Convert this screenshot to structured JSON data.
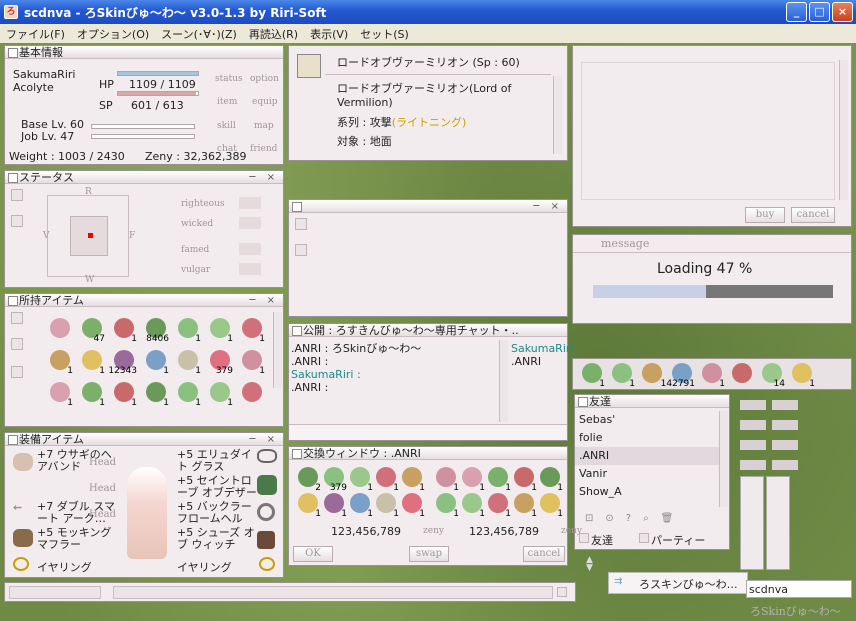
{
  "window": {
    "title": "scdnva - ろSkinびゅ～わ～ v3.0-1.3 by Riri-Soft",
    "controls": [
      "_",
      "□",
      "×"
    ]
  },
  "menu": [
    "ファイル(F)",
    "オプション(O)",
    "スーン(･∀･)(Z)",
    "再読込(R)",
    "表示(V)",
    "セット(S)"
  ],
  "basic": {
    "title": "基本情報",
    "name": "SakumaRiri",
    "job": "Acolyte",
    "hp_label": "HP",
    "hp": "1109 / 1109",
    "sp_label": "SP",
    "sp": "601 / 613",
    "base": "Base Lv. 60",
    "joblv": "Job Lv. 47",
    "weight": "Weight : 1003 / 2430",
    "zeny": "Zeny : 32,362,389",
    "hp_ratio": 1.0,
    "sp_ratio": 0.98,
    "buttons": [
      "status",
      "option",
      "item",
      "equip",
      "skill",
      "map",
      "chat",
      "friend"
    ],
    "ctl": "─ ×"
  },
  "skill": {
    "title": "ロードオブヴァーミリオン (Sp : 60)",
    "line1": "ロードオブヴァーミリオン(Lord of",
    "line2": "Vermilion)",
    "line3a": "系列 : 攻撃",
    "line3b": "(ライトニング)",
    "line4": "対象 : 地面"
  },
  "status": {
    "title": "ステータス",
    "n": "R",
    "s": "W",
    "w": "V",
    "e": "F",
    "labels": [
      "righteous",
      "wicked",
      "famed",
      "vulgar"
    ],
    "ctl": "─ ×"
  },
  "blank": {
    "ctl": "─ ×"
  },
  "items": {
    "title": "所持アイテム",
    "ctl": "─ ×",
    "row1": [
      "",
      "47",
      "1",
      "8406",
      "1",
      "1",
      "1"
    ],
    "row2": [
      "1",
      "1",
      "12343",
      "1",
      "1",
      "379",
      "1"
    ],
    "row3": [
      "1",
      "1",
      "1",
      "1",
      "1",
      "1",
      ""
    ]
  },
  "equip": {
    "title": "装備アイテム",
    "ctl": "─ ×",
    "left": [
      "+7 ウサギのヘアバンド",
      "+7 ダブル スマート アーク…",
      "+5 モッキング マフラー",
      "イヤリング"
    ],
    "right": [
      "+5 エリュダイト グラス",
      "+5 セイントローブ オブデザー",
      "+5 バックラー フロームヘル",
      "+5 シューズ オブ ウィッチ",
      "イヤリング"
    ],
    "ghost": [
      "Head",
      "Head",
      "Head"
    ]
  },
  "chat": {
    "title": "公開 : ろすきんびゅ～わ～専用チャット・..",
    "lines": [
      ".ANRI : ろSkinびゅ～わ～",
      ".ANRI :",
      "SakumaRiri :",
      ".ANRI :"
    ],
    "side": [
      "SakumaRiri",
      ".ANRI"
    ]
  },
  "trade": {
    "title": "交換ウィンドウ : .ANRI",
    "counts_left": [
      "2",
      "379",
      "1",
      "1",
      "1",
      "1",
      "1",
      "1",
      "1",
      "1"
    ],
    "counts_right": [
      "1",
      "1",
      "1",
      "1",
      "1",
      "1",
      "1",
      "1",
      "1",
      "1"
    ],
    "mid_count": "1142",
    "mid_count2": "1",
    "zeny_left": "123,456,789",
    "zeny_right": "123,456,789",
    "zeny_label": "zeny",
    "ok": "OK",
    "swap": "swap",
    "cancel": "cancel"
  },
  "shop": {
    "buy": "buy",
    "cancel": "cancel"
  },
  "message": {
    "title": "message",
    "text": "Loading 47 %",
    "progress": 0.47
  },
  "hotbar": {
    "counts": [
      "1",
      "1",
      "",
      "142791",
      "1",
      "",
      "14",
      "1"
    ]
  },
  "friends": {
    "title": "友達",
    "list": [
      "Sebas'",
      "folie",
      ".ANRI",
      "Vanir",
      "Show_A"
    ],
    "selected": 2,
    "tab1": "友達",
    "tab2": "パーティー"
  },
  "taskbar": {
    "chatlabel": "ろスキンびゅ～わ…",
    "name": "scdnva",
    "logo": "ろSkinびゅ～わ～"
  },
  "colors": {
    "hp": "#a8c4d8",
    "sp": "#d8a8a8",
    "accent": "#c8a000",
    "chatname": "#1a8a8a"
  }
}
